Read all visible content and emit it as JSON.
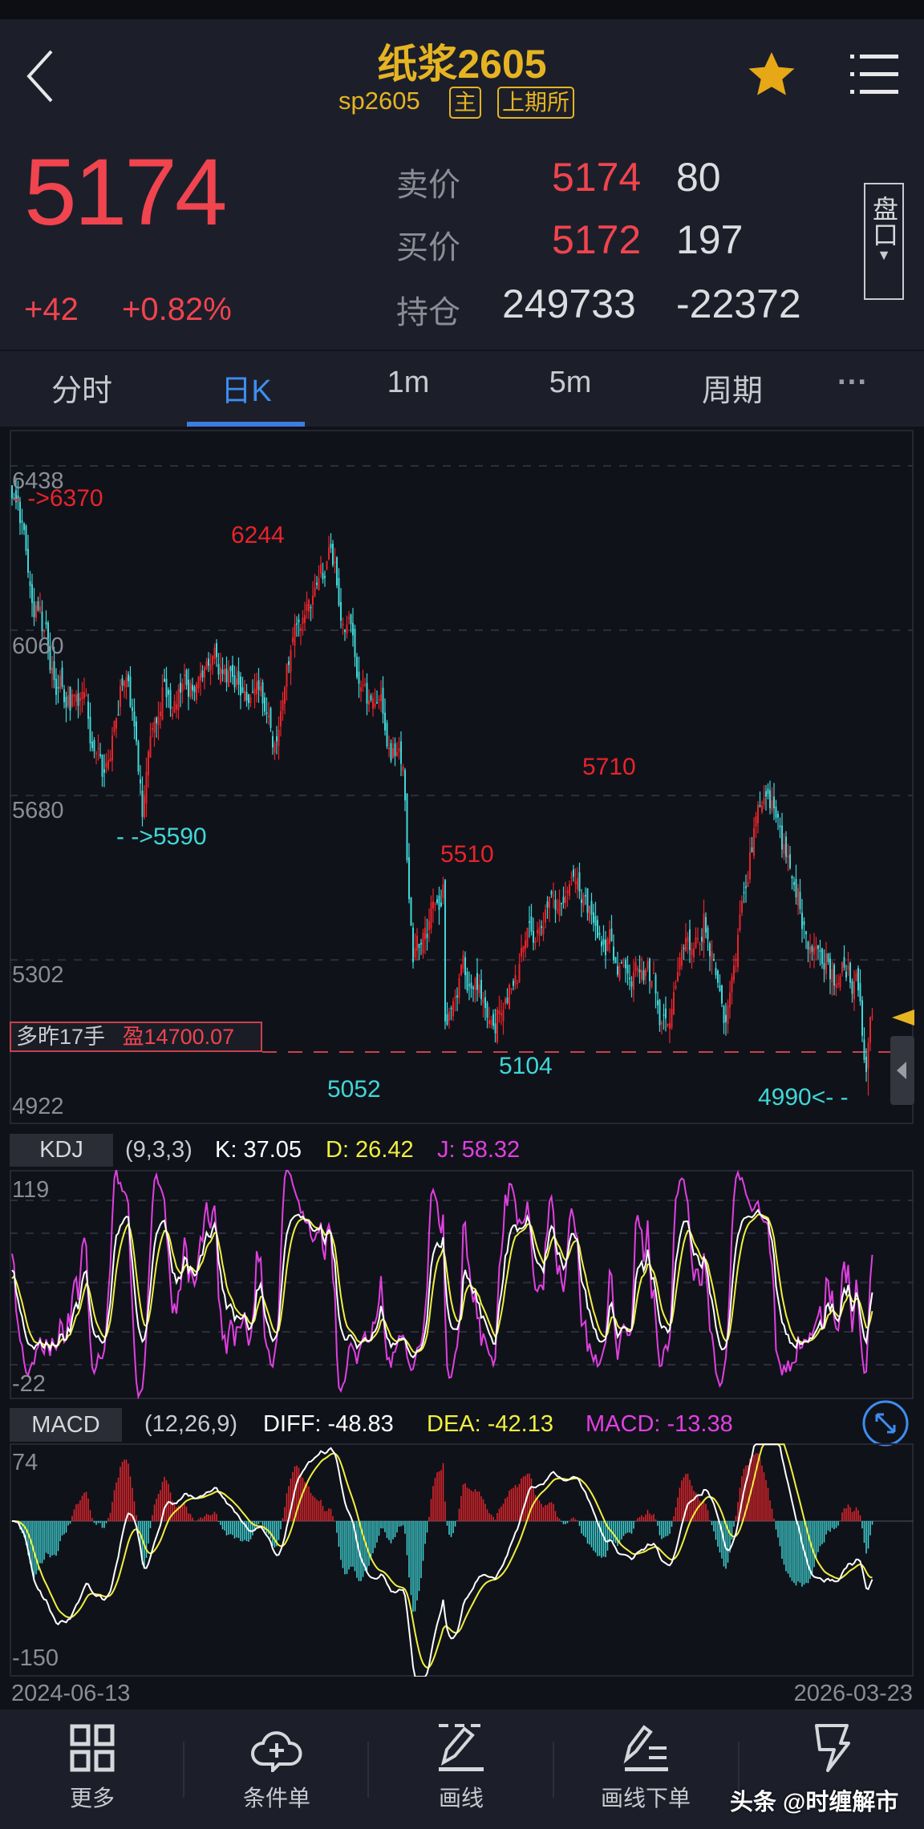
{
  "header": {
    "title": "纸浆2605",
    "code": "sp2605",
    "badge_main": "主",
    "badge_exchange": "上期所",
    "favorited": true
  },
  "quote": {
    "last": "5174",
    "change": "+42",
    "change_pct": "+0.82%",
    "ask_label": "卖价",
    "ask_price": "5174",
    "ask_vol": "80",
    "bid_label": "买价",
    "bid_price": "5172",
    "bid_vol": "197",
    "oi_label": "持仓",
    "oi": "249733",
    "oi_change": "-22372",
    "depth_button": "盘口"
  },
  "tabs": [
    {
      "label": "分时",
      "active": false
    },
    {
      "label": "日K",
      "active": true
    },
    {
      "label": "1m",
      "active": false
    },
    {
      "label": "5m",
      "active": false
    },
    {
      "label": "周期",
      "active": false
    },
    {
      "label": "···",
      "active": false
    }
  ],
  "price_chart": {
    "y_labels": [
      "6438",
      "6060",
      "5680",
      "5302",
      "4922"
    ],
    "annotations": {
      "high_start": "- ->6370",
      "peak": "6244",
      "low1": "- ->5590",
      "peak2": "5710",
      "peak3": "5510",
      "low2": "5052",
      "low3": "5104",
      "low_end": "4990<- -"
    },
    "position": {
      "side": "多昨17手",
      "pnl": "盈14700.07"
    }
  },
  "kdj": {
    "name": "KDJ",
    "params": "(9,3,3)",
    "k": "K: 37.05",
    "d": "D: 26.42",
    "j": "J: 58.32",
    "y_top": "119",
    "y_bottom": "-22"
  },
  "macd": {
    "name": "MACD",
    "params": "(12,26,9)",
    "diff": "DIFF: -48.83",
    "dea": "DEA: -42.13",
    "macd": "MACD: -13.38",
    "y_top": "74",
    "y_bottom": "-150"
  },
  "dates": {
    "start": "2024-06-13",
    "end": "2026-03-23"
  },
  "bottom_nav": [
    {
      "label": "更多",
      "icon": "grid-icon"
    },
    {
      "label": "条件单",
      "icon": "cloud-plus-icon"
    },
    {
      "label": "画线",
      "icon": "pen-icon"
    },
    {
      "label": "画线下单",
      "icon": "pen-order-icon"
    },
    {
      "label": "",
      "icon": "lightning-icon"
    }
  ],
  "watermark": "头条 @时缠解市",
  "colors": {
    "up": "#e8242a",
    "down": "#3fd8d8",
    "gold": "#e6b422",
    "accent": "#3d7de0",
    "k": "#ffffff",
    "d": "#f0f040",
    "j": "#e040e0"
  },
  "chart_data": {
    "type": "candlestick",
    "bars": 430,
    "x_range": [
      "2024-06-13",
      "2026-03-23"
    ],
    "ylim": [
      4922,
      6438
    ],
    "close_path_keypoints": [
      [
        0,
        6330
      ],
      [
        12,
        6150
      ],
      [
        20,
        5980
      ],
      [
        35,
        5880
      ],
      [
        45,
        5720
      ],
      [
        57,
        6030
      ],
      [
        65,
        5650
      ],
      [
        75,
        5900
      ],
      [
        100,
        5960
      ],
      [
        125,
        5850
      ],
      [
        130,
        5800
      ],
      [
        140,
        6050
      ],
      [
        158,
        6200
      ],
      [
        175,
        5950
      ],
      [
        195,
        5720
      ],
      [
        197,
        5520
      ],
      [
        200,
        5250
      ],
      [
        210,
        5420
      ],
      [
        215,
        5480
      ],
      [
        216,
        5150
      ],
      [
        225,
        5280
      ],
      [
        240,
        5190
      ],
      [
        250,
        5250
      ],
      [
        265,
        5380
      ],
      [
        285,
        5480
      ],
      [
        300,
        5330
      ],
      [
        320,
        5250
      ],
      [
        325,
        5160
      ],
      [
        345,
        5420
      ],
      [
        355,
        5200
      ],
      [
        370,
        5600
      ],
      [
        380,
        5620
      ],
      [
        395,
        5400
      ],
      [
        410,
        5280
      ],
      [
        422,
        5250
      ],
      [
        426,
        5050
      ],
      [
        429,
        5174
      ]
    ],
    "marked_high": 6370,
    "marked_low": 4990,
    "position_line": 5083,
    "kdj_ylim": [
      -22,
      119
    ],
    "macd_ylim": [
      -150,
      74
    ]
  }
}
